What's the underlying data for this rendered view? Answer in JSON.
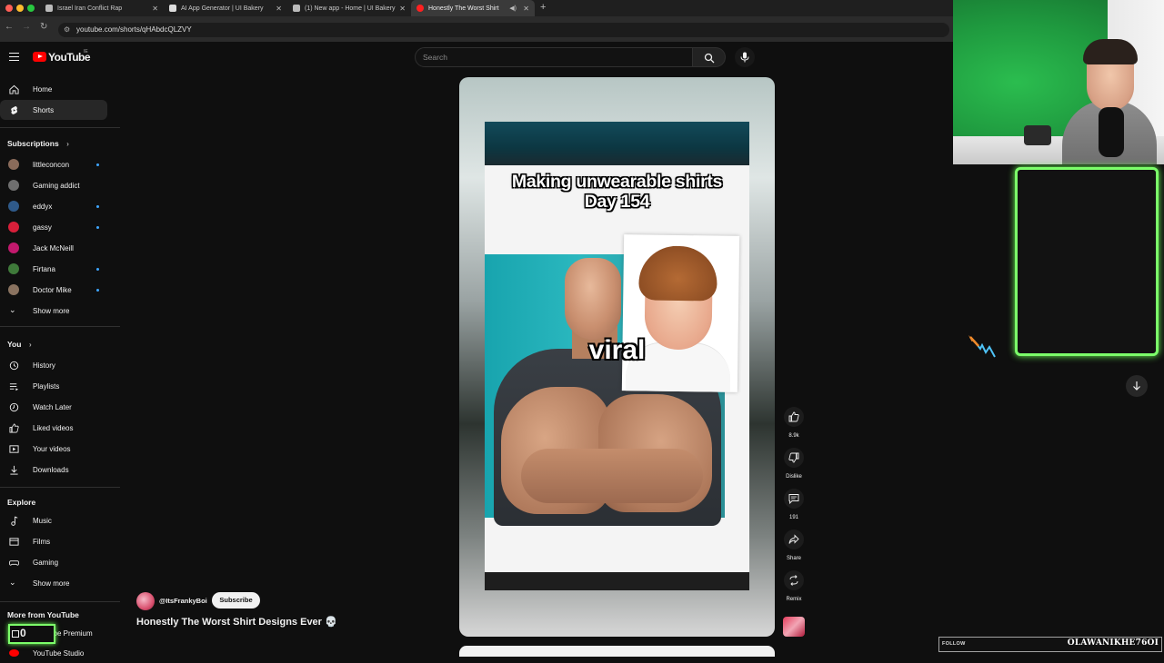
{
  "browser": {
    "tabs": [
      {
        "label": "Israel Iran Conflict Rap",
        "fav": "#bbbbbb"
      },
      {
        "label": "AI App Generator | UI Bakery",
        "fav": "#cccccc"
      },
      {
        "label": "(1) New app - Home | UI Bakery",
        "fav": "#bbbbbb"
      },
      {
        "label": "Honestly The Worst Shirt",
        "fav": "#ff0000"
      }
    ],
    "url": "youtube.com/shorts/qHAbdcQLZVY"
  },
  "header": {
    "logo_text": "YouTube",
    "logo_sup": "IE",
    "search_placeholder": "Search"
  },
  "sidebar": {
    "primary": [
      {
        "label": "Home",
        "icon": "home-icon"
      },
      {
        "label": "Shorts",
        "icon": "shorts-icon",
        "active": true
      }
    ],
    "subscriptions_heading": "Subscriptions",
    "subscriptions": [
      {
        "label": "littleconcon",
        "color": "#8a6b5a",
        "dot": true
      },
      {
        "label": "Gaming addict",
        "color": "#6f6f6f",
        "dot": false
      },
      {
        "label": "eddyx",
        "color": "#2f5a8a",
        "dot": true
      },
      {
        "label": "gassy",
        "color": "#d81f3a",
        "dot": true
      },
      {
        "label": "Jack McNeill",
        "color": "#c2196d",
        "dot": false
      },
      {
        "label": "Firtana",
        "color": "#3f7a3a",
        "dot": true
      },
      {
        "label": "Doctor Mike",
        "color": "#8a7360",
        "dot": true
      }
    ],
    "show_more": "Show more",
    "you_heading": "You",
    "you_items": [
      {
        "label": "History",
        "icon": "history-icon"
      },
      {
        "label": "Playlists",
        "icon": "playlists-icon"
      },
      {
        "label": "Watch Later",
        "icon": "watch-later-icon"
      },
      {
        "label": "Liked videos",
        "icon": "liked-icon"
      },
      {
        "label": "Your videos",
        "icon": "your-videos-icon"
      },
      {
        "label": "Downloads",
        "icon": "downloads-icon"
      }
    ],
    "explore_heading": "Explore",
    "explore_items": [
      {
        "label": "Music",
        "icon": "music-icon"
      },
      {
        "label": "Films",
        "icon": "films-icon"
      },
      {
        "label": "Gaming",
        "icon": "gaming-icon"
      }
    ],
    "explore_show_more": "Show more",
    "more_heading": "More from YouTube",
    "more_items": [
      "YouTube Premium",
      "YouTube Studio"
    ]
  },
  "short": {
    "overlay_title_line1": "Making unwearable shirts",
    "overlay_title_line2": "Day 154",
    "overlay_word": "viral",
    "channel": "@ItsFrankyBoi",
    "subscribe_label": "Subscribe",
    "title": "Honestly The Worst Shirt Designs Ever 💀",
    "actions": [
      {
        "icon": "like-icon",
        "label": "8.9k"
      },
      {
        "icon": "dislike-icon",
        "label": "Dislike"
      },
      {
        "icon": "comments-icon",
        "label": "191"
      },
      {
        "icon": "share-icon",
        "label": "Share"
      },
      {
        "icon": "remix-icon",
        "label": "Remix"
      }
    ]
  },
  "stream_overlay": {
    "counter_value": "0",
    "follow_label": "FOLLOW",
    "follow_name": "OLAWANIKHE76OI"
  }
}
